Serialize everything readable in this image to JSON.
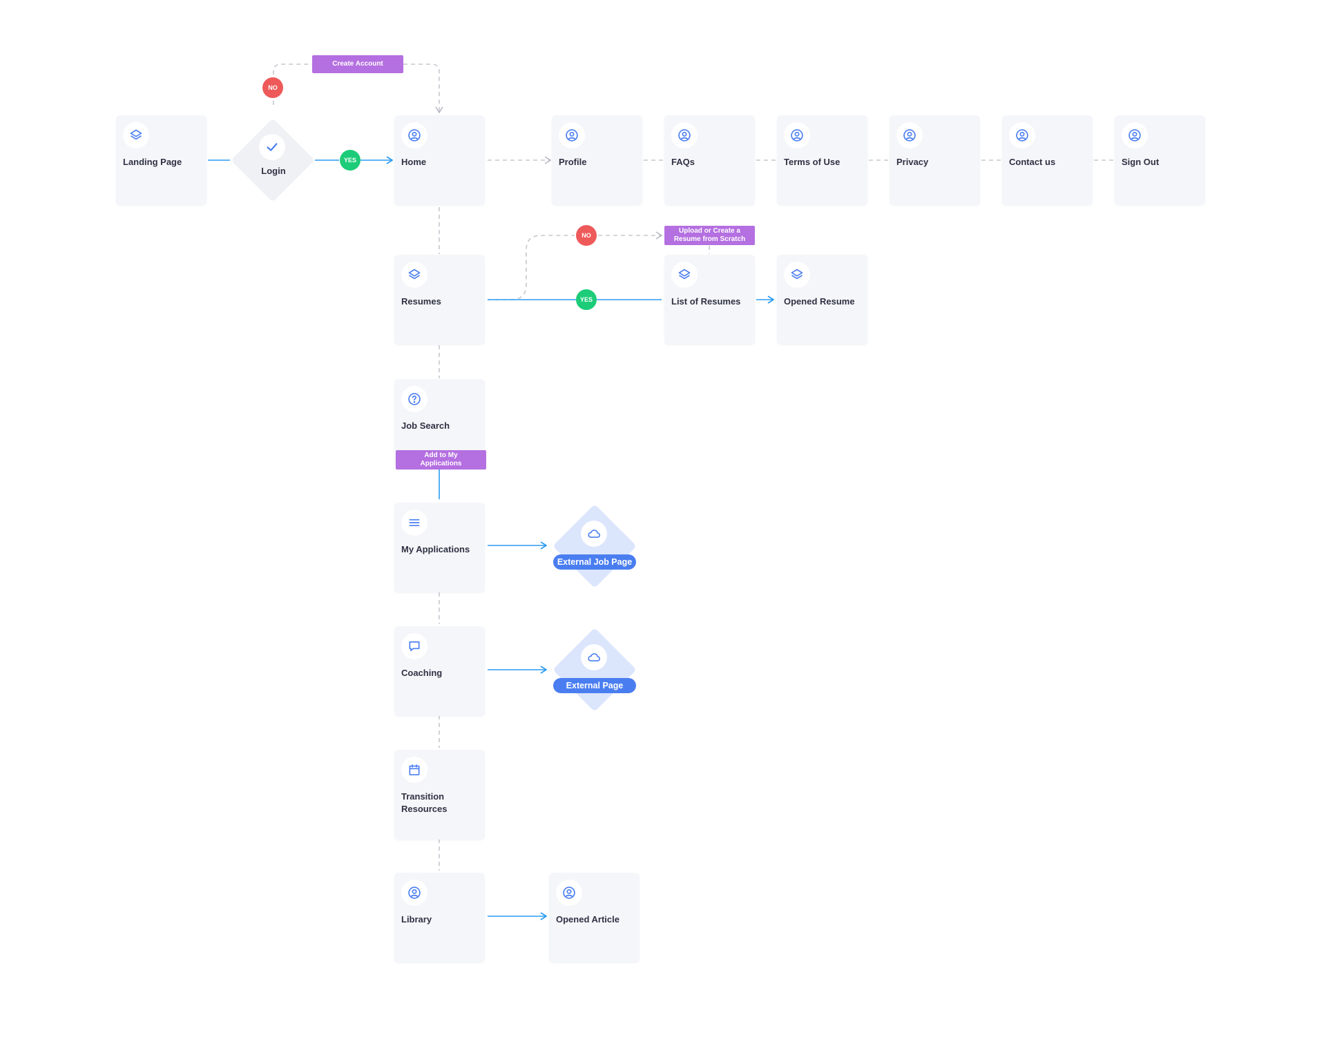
{
  "colors": {
    "accent": "#4a7ef0",
    "flow_line": "#2b9cf2",
    "dashed_line": "#c5c7cf",
    "no_badge": "#ee5a5a",
    "yes_badge": "#1dcc78",
    "tag": "#b46fe0",
    "card_bg": "#f5f6fa"
  },
  "nodes": {
    "landing": {
      "label": "Landing Page",
      "icon": "layers-icon"
    },
    "login": {
      "label": "Login",
      "icon": "check-icon"
    },
    "home": {
      "label": "Home",
      "icon": "user-circle-icon"
    },
    "profile": {
      "label": "Profile",
      "icon": "user-circle-icon"
    },
    "faqs": {
      "label": "FAQs",
      "icon": "user-circle-icon"
    },
    "terms": {
      "label": "Terms of Use",
      "icon": "user-circle-icon"
    },
    "privacy": {
      "label": "Privacy",
      "icon": "user-circle-icon"
    },
    "contact": {
      "label": "Contact us",
      "icon": "user-circle-icon"
    },
    "signout": {
      "label": "Sign Out",
      "icon": "user-circle-icon"
    },
    "resumes": {
      "label": "Resumes",
      "icon": "layers-icon"
    },
    "list_resumes": {
      "label": "List of Resumes",
      "icon": "layers-icon"
    },
    "opened_resume": {
      "label": "Opened Resume",
      "icon": "layers-icon"
    },
    "job_search": {
      "label": "Job Search",
      "icon": "question-circle-icon"
    },
    "my_applications": {
      "label": "My Applications",
      "icon": "menu-icon"
    },
    "external_job": {
      "label": "External Job Page",
      "icon": "cloud-icon"
    },
    "coaching": {
      "label": "Coaching",
      "icon": "chat-icon"
    },
    "external_page": {
      "label": "External Page",
      "icon": "cloud-icon"
    },
    "transition": {
      "label": "Transition Resources",
      "icon": "calendar-icon"
    },
    "library": {
      "label": "Library",
      "icon": "user-circle-icon"
    },
    "opened_article": {
      "label": "Opened Article",
      "icon": "user-circle-icon"
    }
  },
  "badges": {
    "no": "NO",
    "yes": "YES"
  },
  "tags": {
    "create_account": "Create Account",
    "upload_resume": "Upload or Create a Resume from Scratch",
    "add_applications": "Add to My Applications"
  }
}
